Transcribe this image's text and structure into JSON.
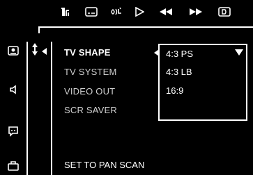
{
  "toolbar": {
    "icons": [
      "audio-settings-icon",
      "subtitle-icon",
      "audio-icon",
      "play-icon",
      "rewind-icon",
      "fast-forward-icon",
      "display-icon"
    ]
  },
  "sidebar": {
    "icons": [
      "video-setup-icon",
      "audio-setup-icon",
      "subtitle-setup-icon",
      "preferences-icon"
    ]
  },
  "menu": {
    "items": [
      {
        "label": "TV SHAPE"
      },
      {
        "label": "TV SYSTEM"
      },
      {
        "label": "VIDEO OUT"
      },
      {
        "label": "SCR SAVER"
      }
    ],
    "active_index": 0
  },
  "options": {
    "items": [
      {
        "label": "4:3 PS"
      },
      {
        "label": "4:3 LB"
      },
      {
        "label": "16:9"
      }
    ],
    "selected": "4:3 PS"
  },
  "status_text": "SET TO PAN SCAN",
  "colors": {
    "background": "#000000",
    "foreground": "#ffffff",
    "inactive_text": "#cfcfcf"
  }
}
